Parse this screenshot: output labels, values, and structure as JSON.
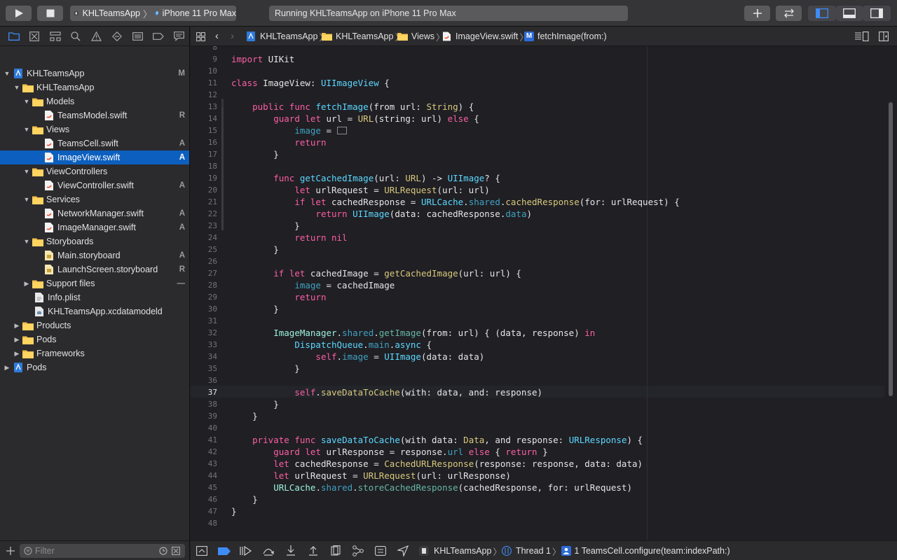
{
  "toolbar": {
    "scheme_target": "KHLTeamsApp",
    "scheme_device": "iPhone 11 Pro Max",
    "status": "Running KHLTeamsApp on iPhone 11 Pro Max"
  },
  "navigator": {
    "rows": [
      {
        "label": "KHLTeamsApp",
        "status": "M"
      },
      {
        "label": "KHLTeamsApp",
        "status": ""
      },
      {
        "label": "Models",
        "status": ""
      },
      {
        "label": "TeamsModel.swift",
        "status": "R"
      },
      {
        "label": "Views",
        "status": ""
      },
      {
        "label": "TeamsCell.swift",
        "status": "A"
      },
      {
        "label": "ImageView.swift",
        "status": "A"
      },
      {
        "label": "ViewControllers",
        "status": ""
      },
      {
        "label": "ViewController.swift",
        "status": "A"
      },
      {
        "label": "Services",
        "status": ""
      },
      {
        "label": "NetworkManager.swift",
        "status": "A"
      },
      {
        "label": "ImageManager.swift",
        "status": "A"
      },
      {
        "label": "Storyboards",
        "status": ""
      },
      {
        "label": "Main.storyboard",
        "status": "A"
      },
      {
        "label": "LaunchScreen.storyboard",
        "status": "R"
      },
      {
        "label": "Support files",
        "status": "—"
      },
      {
        "label": "Info.plist",
        "status": ""
      },
      {
        "label": "KHLTeamsApp.xcdatamodeld",
        "status": ""
      },
      {
        "label": "Products",
        "status": ""
      },
      {
        "label": "Pods",
        "status": ""
      },
      {
        "label": "Frameworks",
        "status": ""
      },
      {
        "label": "Pods",
        "status": ""
      }
    ],
    "filter_placeholder": "Filter"
  },
  "jumpbar": {
    "crumbs": [
      "KHLTeamsApp",
      "KHLTeamsApp",
      "Views",
      "ImageView.swift",
      "fetchImage(from:)"
    ],
    "method_badge": "M"
  },
  "editor": {
    "line_numbers": [
      "8",
      "9",
      "10",
      "11",
      "12",
      "13",
      "14",
      "15",
      "16",
      "17",
      "18",
      "19",
      "20",
      "21",
      "22",
      "23",
      "24",
      "25",
      "26",
      "27",
      "28",
      "29",
      "30",
      "31",
      "32",
      "33",
      "34",
      "35",
      "36",
      "37",
      "38",
      "39",
      "40",
      "41",
      "42",
      "43",
      "44",
      "45",
      "46",
      "47",
      "48"
    ],
    "current_line": "37"
  },
  "debugbar": {
    "target": "KHLTeamsApp",
    "thread": "Thread 1",
    "frame": "1 TeamsCell.configure(team:indexPath:)"
  }
}
